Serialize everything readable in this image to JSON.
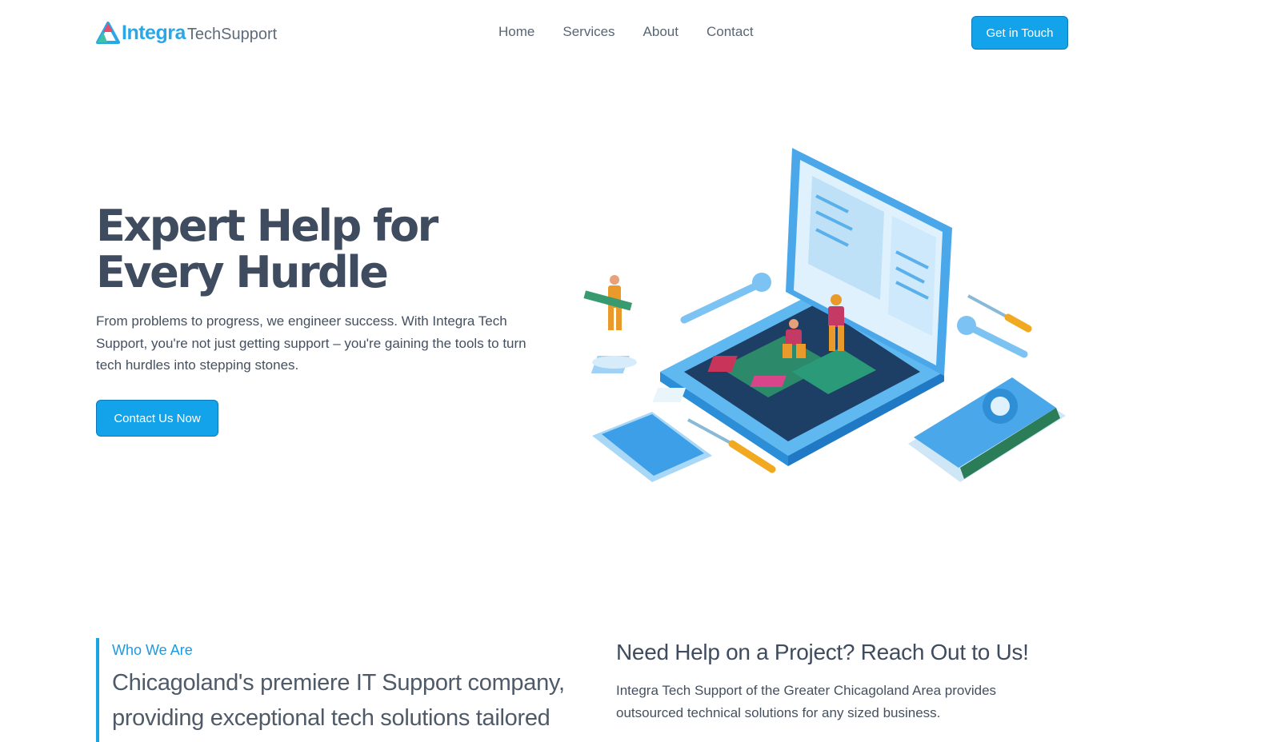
{
  "header": {
    "logo_bold": "Integra",
    "logo_light": "TechSupport",
    "nav": [
      {
        "label": "Home"
      },
      {
        "label": "Services"
      },
      {
        "label": "About"
      },
      {
        "label": "Contact"
      }
    ],
    "cta_label": "Get in Touch"
  },
  "hero": {
    "title": "Expert Help for Every Hurdle",
    "text": "From problems to progress, we engineer success. With Integra Tech Support, you're not just getting support – you're gaining the tools to turn tech hurdles into stepping stones.",
    "button_label": "Contact Us Now"
  },
  "who": {
    "label": "Who We Are",
    "text": "Chicagoland's premiere IT Support company, providing exceptional tech solutions tailored"
  },
  "help": {
    "title": "Need Help on a Project? Reach Out to Us!",
    "text": "Integra Tech Support of the Greater Chicagoland Area provides outsourced technical solutions for any sized business."
  },
  "colors": {
    "accent": "#12a3ea",
    "accent_border": "#0b79b8",
    "heading": "#3f4b5e"
  },
  "icons": [
    "integra-logo-icon",
    "laptop-repair-illustration"
  ]
}
